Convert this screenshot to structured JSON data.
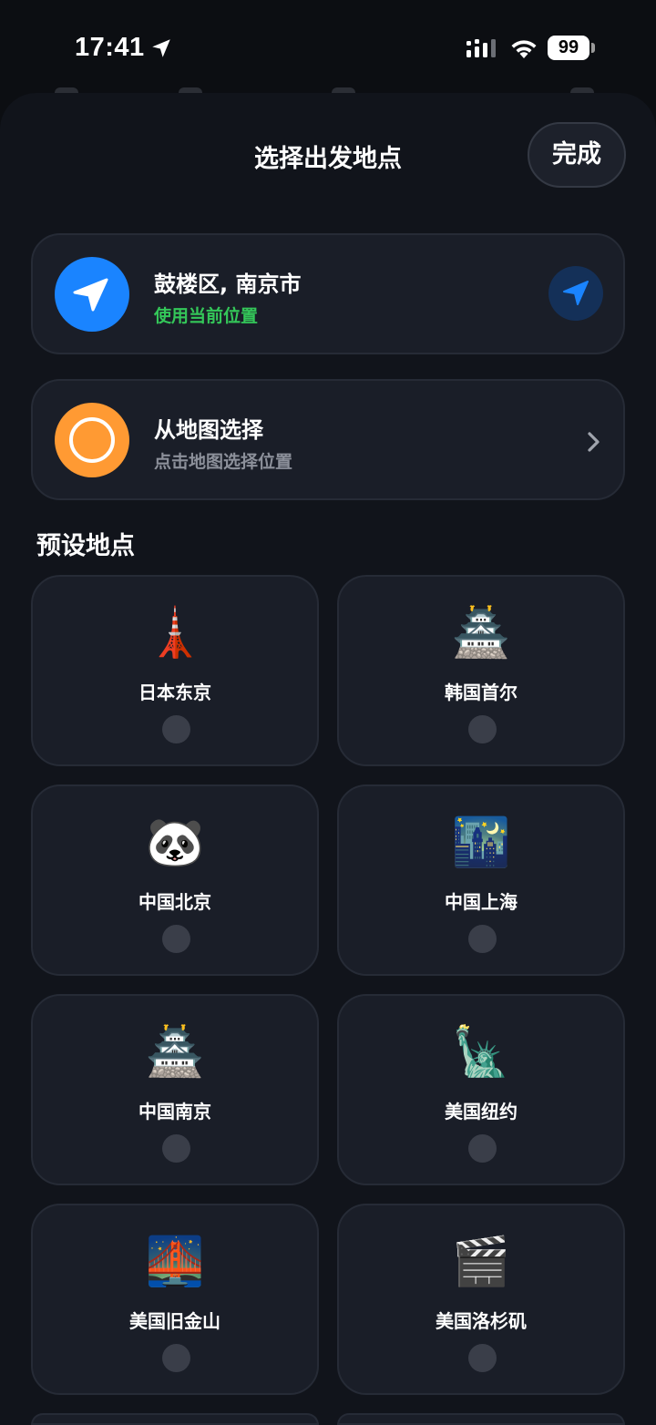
{
  "status_bar": {
    "time": "17:41",
    "battery": "99"
  },
  "sheet": {
    "title": "选择出发地点",
    "done_label": "完成"
  },
  "current_location": {
    "title": "鼓楼区, 南京市",
    "subtitle": "使用当前位置",
    "subtitle_color": "#34c759",
    "icon": "location-arrow-icon",
    "accent": "#1a84ff"
  },
  "map_select": {
    "title": "从地图选择",
    "subtitle": "点击地图选择位置",
    "icon": "circle-target-icon",
    "accent": "#ff9a33"
  },
  "presets": {
    "section_title": "预设地点",
    "items": [
      {
        "label": "日本东京",
        "emoji": "🗼",
        "selected": false
      },
      {
        "label": "韩国首尔",
        "emoji": "🏯",
        "selected": false
      },
      {
        "label": "中国北京",
        "emoji": "🐼",
        "selected": false
      },
      {
        "label": "中国上海",
        "emoji": "🌃",
        "selected": false
      },
      {
        "label": "中国南京",
        "emoji": "🏯",
        "selected": false
      },
      {
        "label": "美国纽约",
        "emoji": "🗽",
        "selected": false
      },
      {
        "label": "美国旧金山",
        "emoji": "🌉",
        "selected": false
      },
      {
        "label": "美国洛杉矶",
        "emoji": "🎬",
        "selected": false
      }
    ]
  }
}
